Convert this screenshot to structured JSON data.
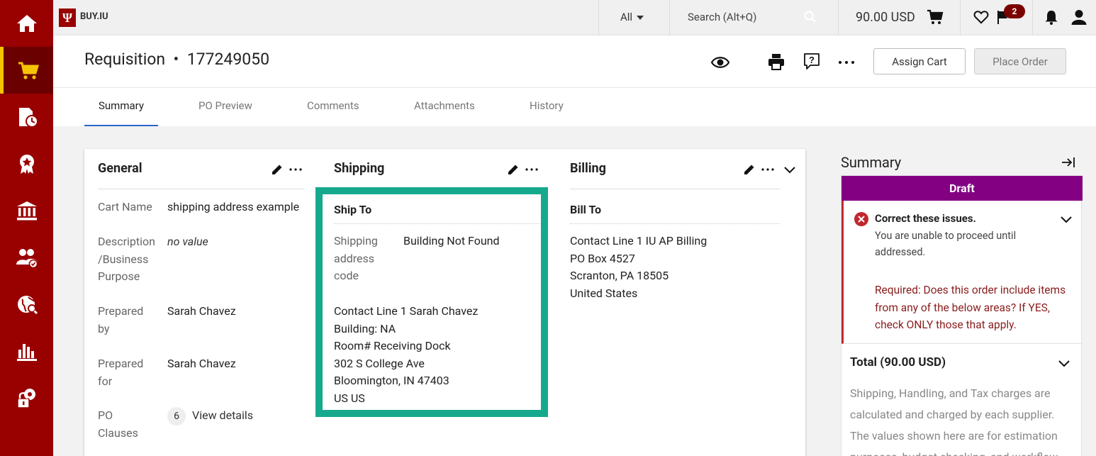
{
  "topbar": {
    "brand": "BUY.IU",
    "logo_glyph": "Ψ",
    "scope": "All",
    "search_placeholder": "Search (Alt+Q)",
    "cart_total": "90.00 USD",
    "flag_badge": "2"
  },
  "sidebar": {
    "items": [
      {
        "icon": "home-icon"
      },
      {
        "icon": "shop-cart-icon",
        "active": true
      },
      {
        "icon": "orders-clock-icon"
      },
      {
        "icon": "award-icon"
      },
      {
        "icon": "bank-icon"
      },
      {
        "icon": "suppliers-icon"
      },
      {
        "icon": "globe-icon"
      },
      {
        "icon": "reports-chart-icon"
      },
      {
        "icon": "admin-gear-lock-icon"
      }
    ]
  },
  "header": {
    "title": "Requisition  •  177249050",
    "assign_cart": "Assign Cart",
    "place_order": "Place Order",
    "tabs": [
      {
        "label": "Summary",
        "active": true
      },
      {
        "label": "PO Preview"
      },
      {
        "label": "Comments"
      },
      {
        "label": "Attachments"
      },
      {
        "label": "History"
      }
    ]
  },
  "general": {
    "title": "General",
    "cart_name_label": "Cart Name",
    "cart_name_value": "shipping address example",
    "description_label_1": "Description",
    "description_label_2": "/Business",
    "description_label_3": "Purpose",
    "description_value": "no value",
    "prepared_by_label_1": "Prepared",
    "prepared_by_label_2": "by",
    "prepared_by_value": "Sarah Chavez",
    "prepared_for_label_1": "Prepared",
    "prepared_for_label_2": "for",
    "prepared_for_value": "Sarah Chavez",
    "po_clauses_label_1": "PO",
    "po_clauses_label_2": "Clauses",
    "po_clauses_count": "6",
    "po_clauses_link": "View details"
  },
  "shipping": {
    "title": "Shipping",
    "ship_to_title": "Ship To",
    "code_label_1": "Shipping",
    "code_label_2": "address",
    "code_label_3": "code",
    "code_value": "Building Not Found",
    "address_lines": [
      "Contact Line 1 Sarah Chavez",
      "Building: NA",
      "Room# Receiving Dock",
      "302 S College Ave",
      "Bloomington, IN 47403",
      "US US"
    ]
  },
  "billing": {
    "title": "Billing",
    "bill_to_title": "Bill To",
    "address_lines": [
      "Contact Line 1 IU AP Billing",
      "PO Box 4527",
      "Scranton, PA 18505",
      "United States"
    ]
  },
  "summary": {
    "title": "Summary",
    "status": "Draft",
    "issues_title": "Correct these issues.",
    "issues_text": "You are unable to proceed until addressed.",
    "issues_required": "Required: Does this order include items from any of the below areas? If YES, check ONLY those that apply.",
    "total_title": "Total (90.00 USD)",
    "total_text": "Shipping, Handling, and Tax charges are calculated and charged by each supplier. The values shown here are for estimation purposes, budget checking, and workflow."
  },
  "colors": {
    "sidebar": "#990000",
    "active_accent": "#f5c400",
    "highlight_box": "#16a98e",
    "draft_banner": "#830083",
    "error": "#c0282d"
  }
}
